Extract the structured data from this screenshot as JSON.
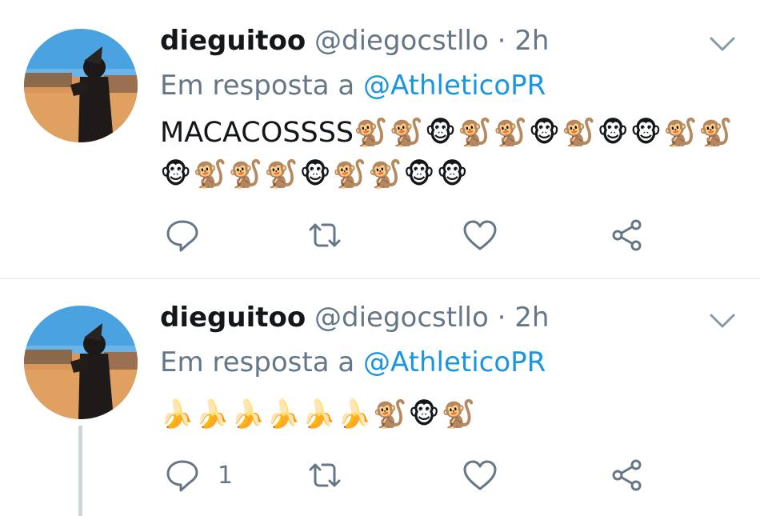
{
  "tweets": [
    {
      "name": "dieguitoo",
      "handle": "@diegocstllo",
      "separator": "·",
      "time": "2h",
      "reply_prefix": "Em resposta a",
      "reply_to": "@AthleticoPR",
      "text": "MACACOSSSS",
      "emojis": "🐒🐒🐵🐒🐒🐵🐒🐵🐵🐒🐒🐵🐒🐒🐒🐵🐒🐒🐵🐵",
      "reply_count": ""
    },
    {
      "name": "dieguitoo",
      "handle": "@diegocstllo",
      "separator": "·",
      "time": "2h",
      "reply_prefix": "Em resposta a",
      "reply_to": "@AthleticoPR",
      "text": "",
      "emojis": "🍌🍌🍌🍌🍌🍌🐒🐵🐒",
      "reply_count": "1"
    }
  ],
  "icons": {
    "reply": "reply-icon",
    "retweet": "retweet-icon",
    "like": "heart-icon",
    "share": "share-icon",
    "caret": "chevron-down-icon"
  },
  "colors": {
    "name": "#14171a",
    "secondary": "#657786",
    "mention": "#1b95e0",
    "divider": "#e1e8ed",
    "thread_line": "#ccd6dd"
  }
}
